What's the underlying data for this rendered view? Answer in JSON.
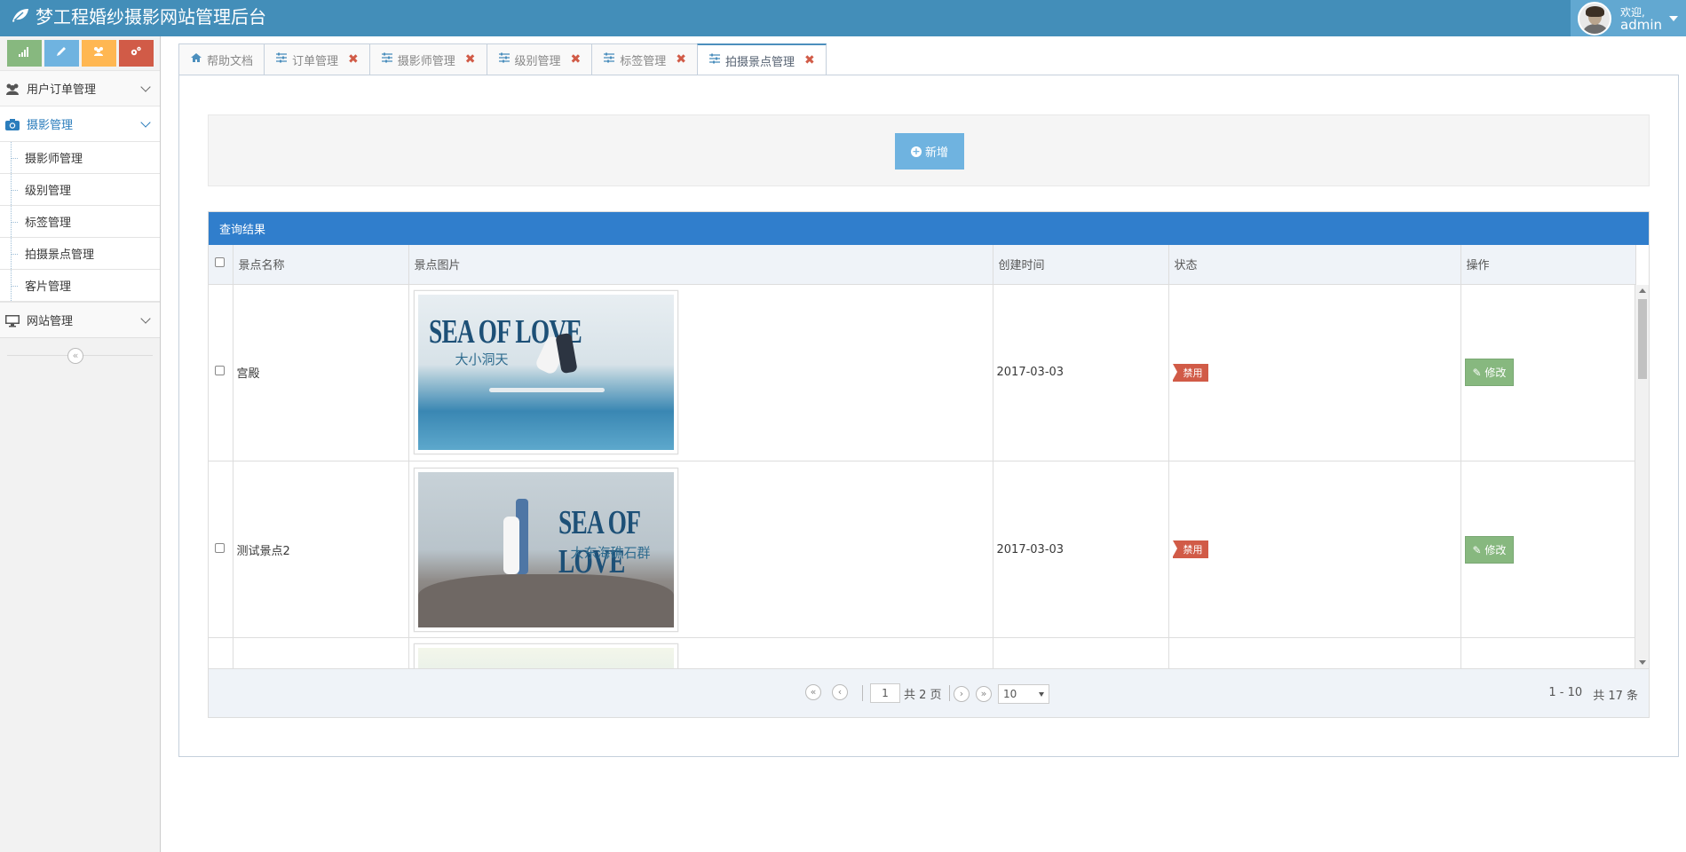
{
  "header": {
    "title": "梦工程婚纱摄影网站管理后台",
    "welcome": "欢迎,",
    "username": "admin"
  },
  "sidebar": {
    "shortcuts": [
      "signal-icon",
      "pencil-icon",
      "users-icon",
      "cogs-icon"
    ],
    "menu": [
      {
        "label": "用户订单管理",
        "icon": "users-icon"
      },
      {
        "label": "摄影管理",
        "icon": "camera-icon",
        "active": true,
        "children": [
          "摄影师管理",
          "级别管理",
          "标签管理",
          "拍摄景点管理",
          "客片管理"
        ]
      },
      {
        "label": "网站管理",
        "icon": "desktop-icon"
      }
    ],
    "collapse_symbol": "«"
  },
  "tabs": [
    {
      "label": "帮助文档",
      "icon": "home-icon",
      "closable": false
    },
    {
      "label": "订单管理",
      "icon": "sliders-icon",
      "closable": true
    },
    {
      "label": "摄影师管理",
      "icon": "sliders-icon",
      "closable": true
    },
    {
      "label": "级别管理",
      "icon": "sliders-icon",
      "closable": true
    },
    {
      "label": "标签管理",
      "icon": "sliders-icon",
      "closable": true
    },
    {
      "label": "拍摄景点管理",
      "icon": "sliders-icon",
      "closable": true,
      "active": true
    }
  ],
  "close_symbol": "✖",
  "toolbar": {
    "add_label": "新增"
  },
  "grid": {
    "caption": "查询结果",
    "columns": [
      "景点名称",
      "景点图片",
      "创建时间",
      "状态",
      "操作"
    ],
    "rows": [
      {
        "name": "宫殿",
        "image_title": "SEA OF LOVE",
        "image_sub": "大小洞天",
        "created": "2017-03-03",
        "status": "禁用",
        "action": "修改"
      },
      {
        "name": "测试景点2",
        "image_title": "SEA OF LOVE",
        "image_sub": "大东海礁石群",
        "created": "2017-03-03",
        "status": "禁用",
        "action": "修改"
      }
    ]
  },
  "pager": {
    "page": "1",
    "total_pages": "共 2 页",
    "page_size": "10",
    "range": "1 - 10",
    "total": "共 17 条",
    "first": "«",
    "prev": "‹",
    "next": "›",
    "last": "»"
  },
  "colors": {
    "header": "#438eb9",
    "caption": "#307ecc",
    "add": "#6fb3e0",
    "edit": "#87b87f",
    "status": "#d15b47"
  }
}
